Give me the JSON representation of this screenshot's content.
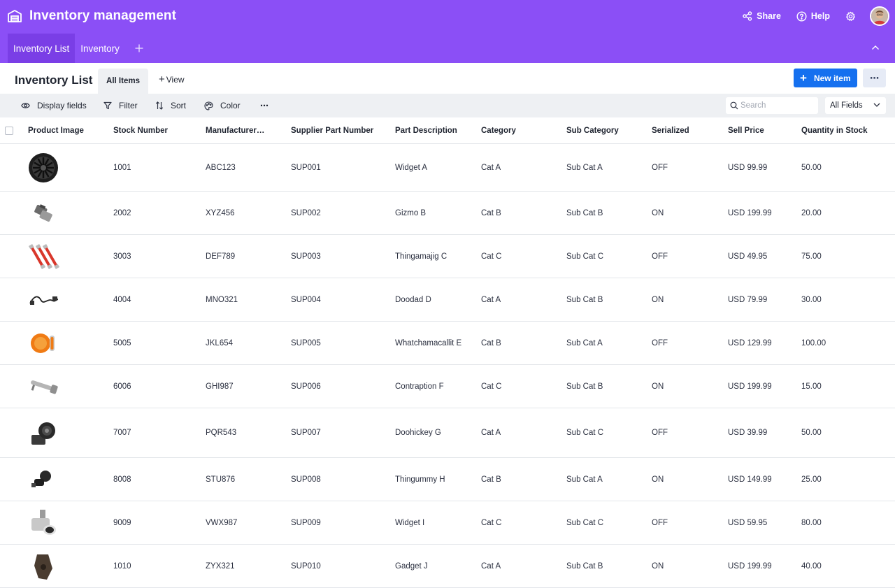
{
  "app": {
    "title": "Inventory management",
    "share_label": "Share",
    "help_label": "Help"
  },
  "tabs": [
    {
      "label": "Inventory List",
      "active": true
    },
    {
      "label": "Inventory",
      "active": false
    }
  ],
  "view": {
    "title": "Inventory List",
    "active_view": "All Items",
    "add_view_label": "View",
    "new_item_label": "New item",
    "more_label": "⋯"
  },
  "toolbar": {
    "display_fields": "Display fields",
    "filter": "Filter",
    "sort": "Sort",
    "color": "Color",
    "more": "⋯",
    "search_placeholder": "Search",
    "fields_scope": "All Fields"
  },
  "columns": [
    "Product Image",
    "Stock Number",
    "Manufacturer…",
    "Supplier Part Number",
    "Part Description",
    "Category",
    "Sub Category",
    "Serialized",
    "Sell Price",
    "Quantity in Stock"
  ],
  "rows": [
    {
      "image": "wheel-icon",
      "stock": "1001",
      "mfr": "ABC123",
      "supplier": "SUP001",
      "desc": "Widget A",
      "category": "Cat A",
      "sub": "Sub Cat A",
      "serialized": "OFF",
      "price": "USD 99.99",
      "qty": "50.00"
    },
    {
      "image": "brake-pad-icon",
      "stock": "2002",
      "mfr": "XYZ456",
      "supplier": "SUP002",
      "desc": "Gizmo B",
      "category": "Cat B",
      "sub": "Sub Cat B",
      "serialized": "ON",
      "price": "USD 199.99",
      "qty": "20.00"
    },
    {
      "image": "shock-absorber-icon",
      "stock": "3003",
      "mfr": "DEF789",
      "supplier": "SUP003",
      "desc": "Thingamajig C",
      "category": "Cat C",
      "sub": "Sub Cat C",
      "serialized": "OFF",
      "price": "USD 49.95",
      "qty": "75.00"
    },
    {
      "image": "sensor-cable-icon",
      "stock": "4004",
      "mfr": "MNO321",
      "supplier": "SUP004",
      "desc": "Doodad D",
      "category": "Cat A",
      "sub": "Sub Cat B",
      "serialized": "ON",
      "price": "USD 79.99",
      "qty": "30.00"
    },
    {
      "image": "signal-lamp-icon",
      "stock": "5005",
      "mfr": "JKL654",
      "supplier": "SUP005",
      "desc": "Whatchamacallit E",
      "category": "Cat B",
      "sub": "Sub Cat A",
      "serialized": "OFF",
      "price": "USD 129.99",
      "qty": "100.00"
    },
    {
      "image": "exhaust-pipe-icon",
      "stock": "6006",
      "mfr": "GHI987",
      "supplier": "SUP006",
      "desc": "Contraption F",
      "category": "Cat C",
      "sub": "Sub Cat B",
      "serialized": "ON",
      "price": "USD 199.99",
      "qty": "15.00"
    },
    {
      "image": "speaker-icon",
      "stock": "7007",
      "mfr": "PQR543",
      "supplier": "SUP007",
      "desc": "Doohickey G",
      "category": "Cat A",
      "sub": "Sub Cat C",
      "serialized": "OFF",
      "price": "USD 39.99",
      "qty": "50.00"
    },
    {
      "image": "mount-icon",
      "stock": "8008",
      "mfr": "STU876",
      "supplier": "SUP008",
      "desc": "Thingummy H",
      "category": "Cat B",
      "sub": "Sub Cat A",
      "serialized": "ON",
      "price": "USD 149.99",
      "qty": "25.00"
    },
    {
      "image": "muffler-tip-icon",
      "stock": "9009",
      "mfr": "VWX987",
      "supplier": "SUP009",
      "desc": "Widget I",
      "category": "Cat C",
      "sub": "Sub Cat C",
      "serialized": "OFF",
      "price": "USD 59.95",
      "qty": "80.00"
    },
    {
      "image": "bracket-icon",
      "stock": "1010",
      "mfr": "ZYX321",
      "supplier": "SUP010",
      "desc": "Gadget J",
      "category": "Cat A",
      "sub": "Sub Cat B",
      "serialized": "ON",
      "price": "USD 199.99",
      "qty": "40.00"
    }
  ],
  "colors": {
    "header_bg": "#8b4ff6",
    "active_tab_bg": "#7a3ee6",
    "primary_button": "#1570ef",
    "toolbar_bg": "#eef0f3"
  }
}
